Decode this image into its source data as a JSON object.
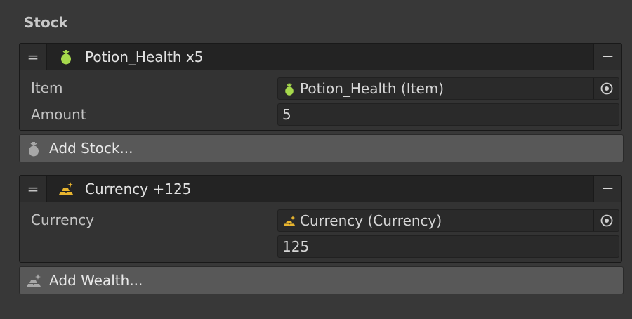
{
  "section": {
    "title": "Stock"
  },
  "stock_entry": {
    "header_icon": "potion-icon",
    "title": "Potion_Health x5",
    "drag_glyph": "=",
    "remove_glyph": "−",
    "fields": [
      {
        "label": "Item",
        "value": "Potion_Health (Item)",
        "icon": "potion-icon"
      },
      {
        "label": "Amount",
        "value": "5"
      }
    ]
  },
  "add_stock": {
    "label": "Add Stock...",
    "icon": "potion-icon"
  },
  "wealth_entry": {
    "header_icon": "gold-bars-icon",
    "title": "Currency +125",
    "drag_glyph": "=",
    "remove_glyph": "−",
    "fields": [
      {
        "label": "Currency",
        "value": "Currency (Currency)",
        "icon": "gold-bars-icon"
      },
      {
        "label": "",
        "value": "125"
      }
    ]
  },
  "add_wealth": {
    "label": "Add Wealth...",
    "icon": "gold-bars-icon"
  },
  "colors": {
    "potion": "#a6d94c",
    "gold": "#e8b52f",
    "background": "#383838",
    "header": "#232323",
    "add_button": "#585858"
  }
}
